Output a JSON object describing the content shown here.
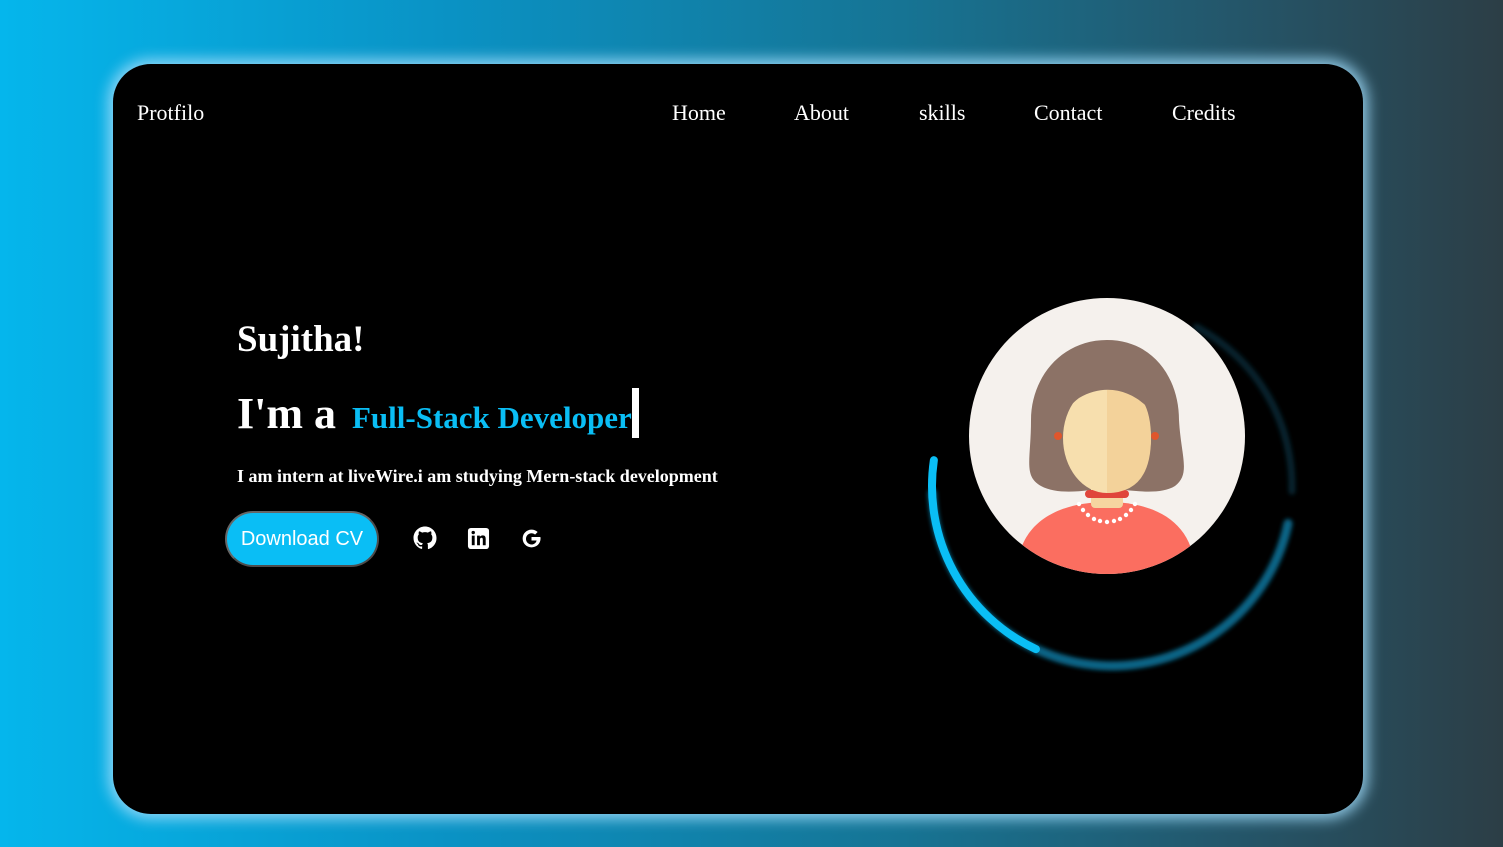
{
  "header": {
    "logo": "Protfilo",
    "nav": [
      "Home",
      "About",
      "skills",
      "Contact",
      "Credits"
    ]
  },
  "hero": {
    "name": "Sujitha!",
    "role_prefix": "I'm a",
    "role_typed": "Full-Stack Developer",
    "bio": "I am intern at liveWire.i am studying Mern-stack development",
    "cta_label": "Download CV",
    "socials": [
      "github-icon",
      "linkedin-icon",
      "google-icon"
    ]
  },
  "colors": {
    "accent": "#0abef5",
    "card": "#000000",
    "text": "#ffffff"
  }
}
